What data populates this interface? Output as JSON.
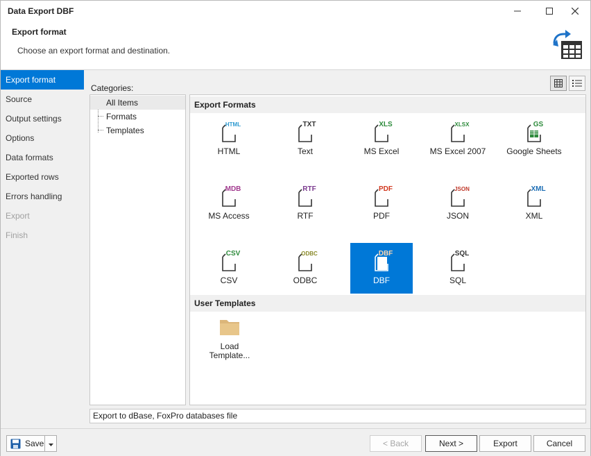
{
  "window": {
    "title": "Data Export DBF"
  },
  "header": {
    "title": "Export format",
    "subtitle": "Choose an export format and destination."
  },
  "nav": {
    "items": [
      {
        "label": "Export format",
        "state": "active"
      },
      {
        "label": "Source",
        "state": "normal"
      },
      {
        "label": "Output settings",
        "state": "normal"
      },
      {
        "label": "Options",
        "state": "normal"
      },
      {
        "label": "Data formats",
        "state": "normal"
      },
      {
        "label": "Exported rows",
        "state": "normal"
      },
      {
        "label": "Errors handling",
        "state": "normal"
      },
      {
        "label": "Export",
        "state": "disabled"
      },
      {
        "label": "Finish",
        "state": "disabled"
      }
    ]
  },
  "categories": {
    "label": "Categories:",
    "items": [
      "All Items",
      "Formats",
      "Templates"
    ],
    "selected": "All Items"
  },
  "groups": {
    "export_formats": "Export Formats",
    "user_templates": "User Templates"
  },
  "formats": [
    {
      "label": "HTML",
      "tag": "HTML",
      "color": "#2e9ad0"
    },
    {
      "label": "Text",
      "tag": "TXT",
      "color": "#333333"
    },
    {
      "label": "MS Excel",
      "tag": "XLS",
      "color": "#2e8b3c"
    },
    {
      "label": "MS Excel 2007",
      "tag": "XLSX",
      "color": "#2e8b3c"
    },
    {
      "label": "Google Sheets",
      "tag": "GS",
      "color": "#2e8b3c"
    },
    {
      "label": "MS Access",
      "tag": "MDB",
      "color": "#a23b8f"
    },
    {
      "label": "RTF",
      "tag": "RTF",
      "color": "#7b3a8f"
    },
    {
      "label": "PDF",
      "tag": "PDF",
      "color": "#d2381f"
    },
    {
      "label": "JSON",
      "tag": "JSON",
      "color": "#c0392b"
    },
    {
      "label": "XML",
      "tag": "XML",
      "color": "#1e6fb5"
    },
    {
      "label": "CSV",
      "tag": "CSV",
      "color": "#2e8b3c"
    },
    {
      "label": "ODBC",
      "tag": "ODBC",
      "color": "#8a8a2a"
    },
    {
      "label": "DBF",
      "tag": "DBF",
      "color": "#e07a2a",
      "selected": true
    },
    {
      "label": "SQL",
      "tag": "SQL",
      "color": "#333333"
    }
  ],
  "templates": [
    {
      "label_line1": "Load",
      "label_line2": "Template..."
    }
  ],
  "status": {
    "text": "Export to dBase, FoxPro databases file"
  },
  "footer": {
    "save": "Save",
    "back": "< Back",
    "next": "Next >",
    "export": "Export",
    "cancel": "Cancel"
  }
}
